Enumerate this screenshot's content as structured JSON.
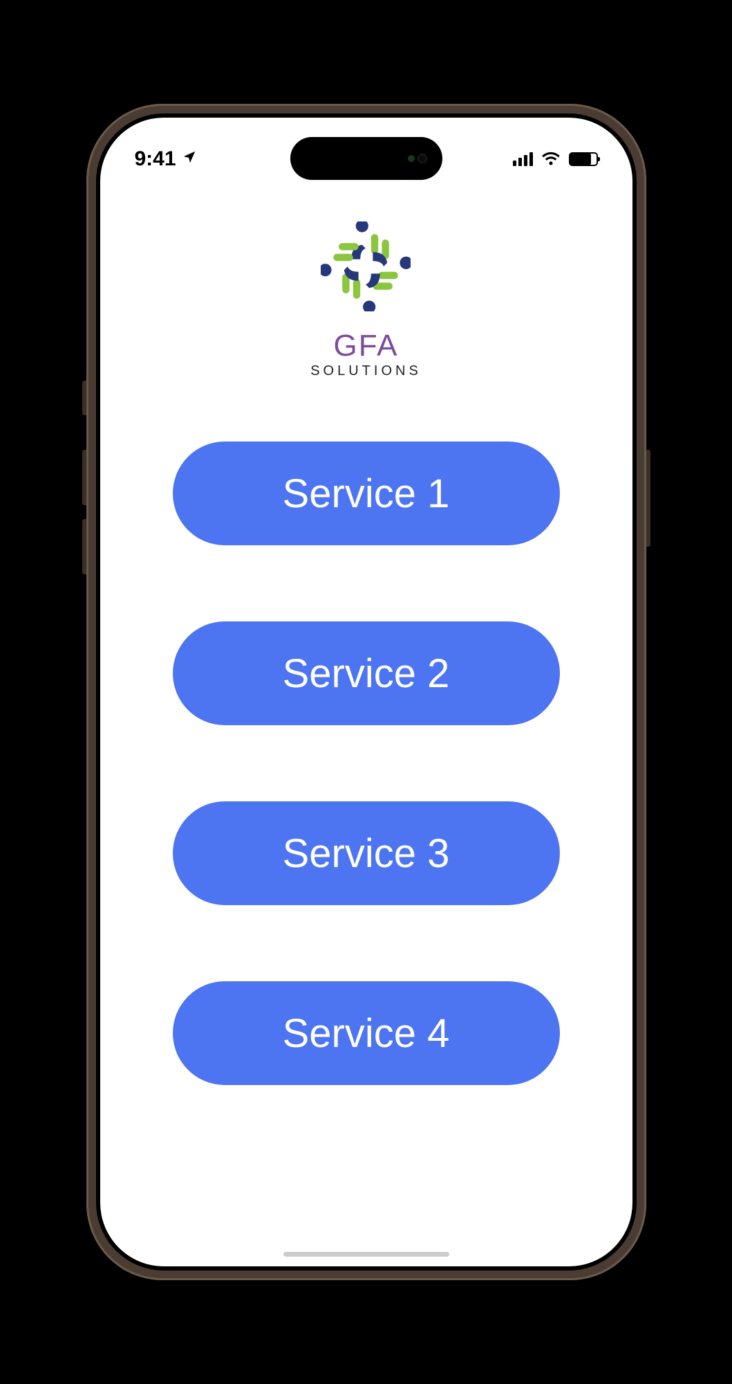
{
  "status_bar": {
    "time": "9:41",
    "location_icon": "location-arrow-icon",
    "signal_icon": "cellular-signal-icon",
    "wifi_icon": "wifi-icon",
    "battery_icon": "battery-icon"
  },
  "brand": {
    "name": "GFA",
    "subtitle": "SOLUTIONS",
    "logo_icon": "gfa-logo-icon",
    "logo_colors": {
      "accent": "#8cc63f",
      "primary": "#26387a"
    }
  },
  "buttons": [
    {
      "label": "Service 1"
    },
    {
      "label": "Service 2"
    },
    {
      "label": "Service 3"
    },
    {
      "label": "Service 4"
    }
  ],
  "colors": {
    "button_bg": "#4d74f1",
    "button_text": "#ffffff",
    "brand_text": "#7b4a9c"
  }
}
